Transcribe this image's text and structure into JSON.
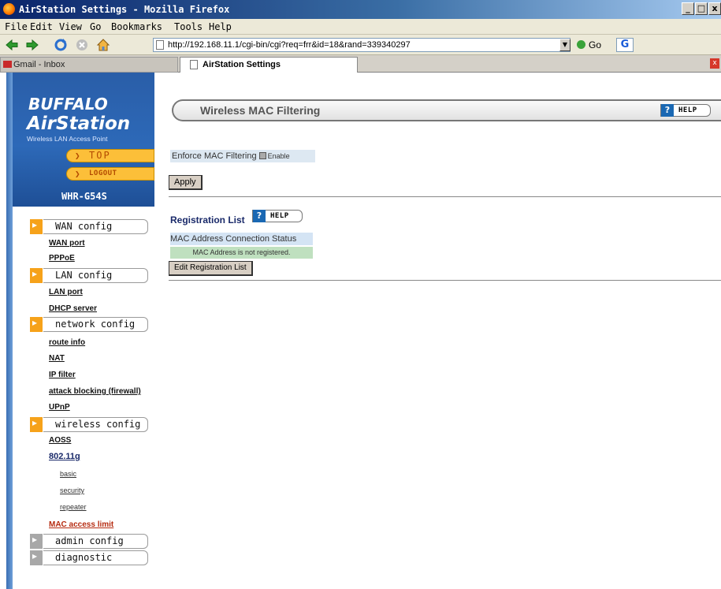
{
  "window": {
    "title": "AirStation Settings - Mozilla Firefox",
    "buttons": {
      "minimize": "_",
      "maximize": "□",
      "close": "x"
    }
  },
  "menubar": [
    "File",
    "Edit",
    "View",
    "Go",
    "Bookmarks",
    "Tools",
    "Help"
  ],
  "navbar": {
    "url": "http://192.168.11.1/cgi-bin/cgi?req=frr&id=18&rand=339340297",
    "go_label": "Go",
    "search_engine_glyph": "G"
  },
  "tabs": [
    {
      "label": "Gmail - Inbox",
      "active": false
    },
    {
      "label": "AirStation Settings",
      "active": true
    }
  ],
  "sidebar": {
    "brand": "BUFFALO",
    "product": "AirStation",
    "tagline": "Wireless LAN Access Point",
    "top_label": "TOP",
    "logout_label": "LOGOUT",
    "model": "WHR-G54S",
    "sections": {
      "wan": {
        "label": "WAN config",
        "links": [
          "WAN port",
          "PPPoE"
        ]
      },
      "lan": {
        "label": "LAN config",
        "links": [
          "LAN port",
          "DHCP server"
        ]
      },
      "network": {
        "label": "network config",
        "links": [
          "route info",
          "NAT",
          "IP filter",
          "attack blocking (firewall)",
          "UPnP"
        ]
      },
      "wireless": {
        "label": "wireless config",
        "links": [
          "AOSS",
          "802.11g"
        ],
        "sublinks": [
          "basic",
          "security",
          "repeater"
        ],
        "active_link": "MAC access limit"
      },
      "admin": {
        "label": "admin config"
      },
      "diagnostic": {
        "label": "diagnostic"
      }
    }
  },
  "main": {
    "title": "Wireless MAC Filtering",
    "help_label": "HELP",
    "enforce_label": "Enforce MAC Filtering",
    "enable_label": "Enable",
    "enable_checked": false,
    "apply_label": "Apply",
    "registration_title": "Registration List",
    "column_header": "MAC Address Connection Status",
    "empty_message": "MAC Address is not registered.",
    "edit_label": "Edit Registration List"
  }
}
